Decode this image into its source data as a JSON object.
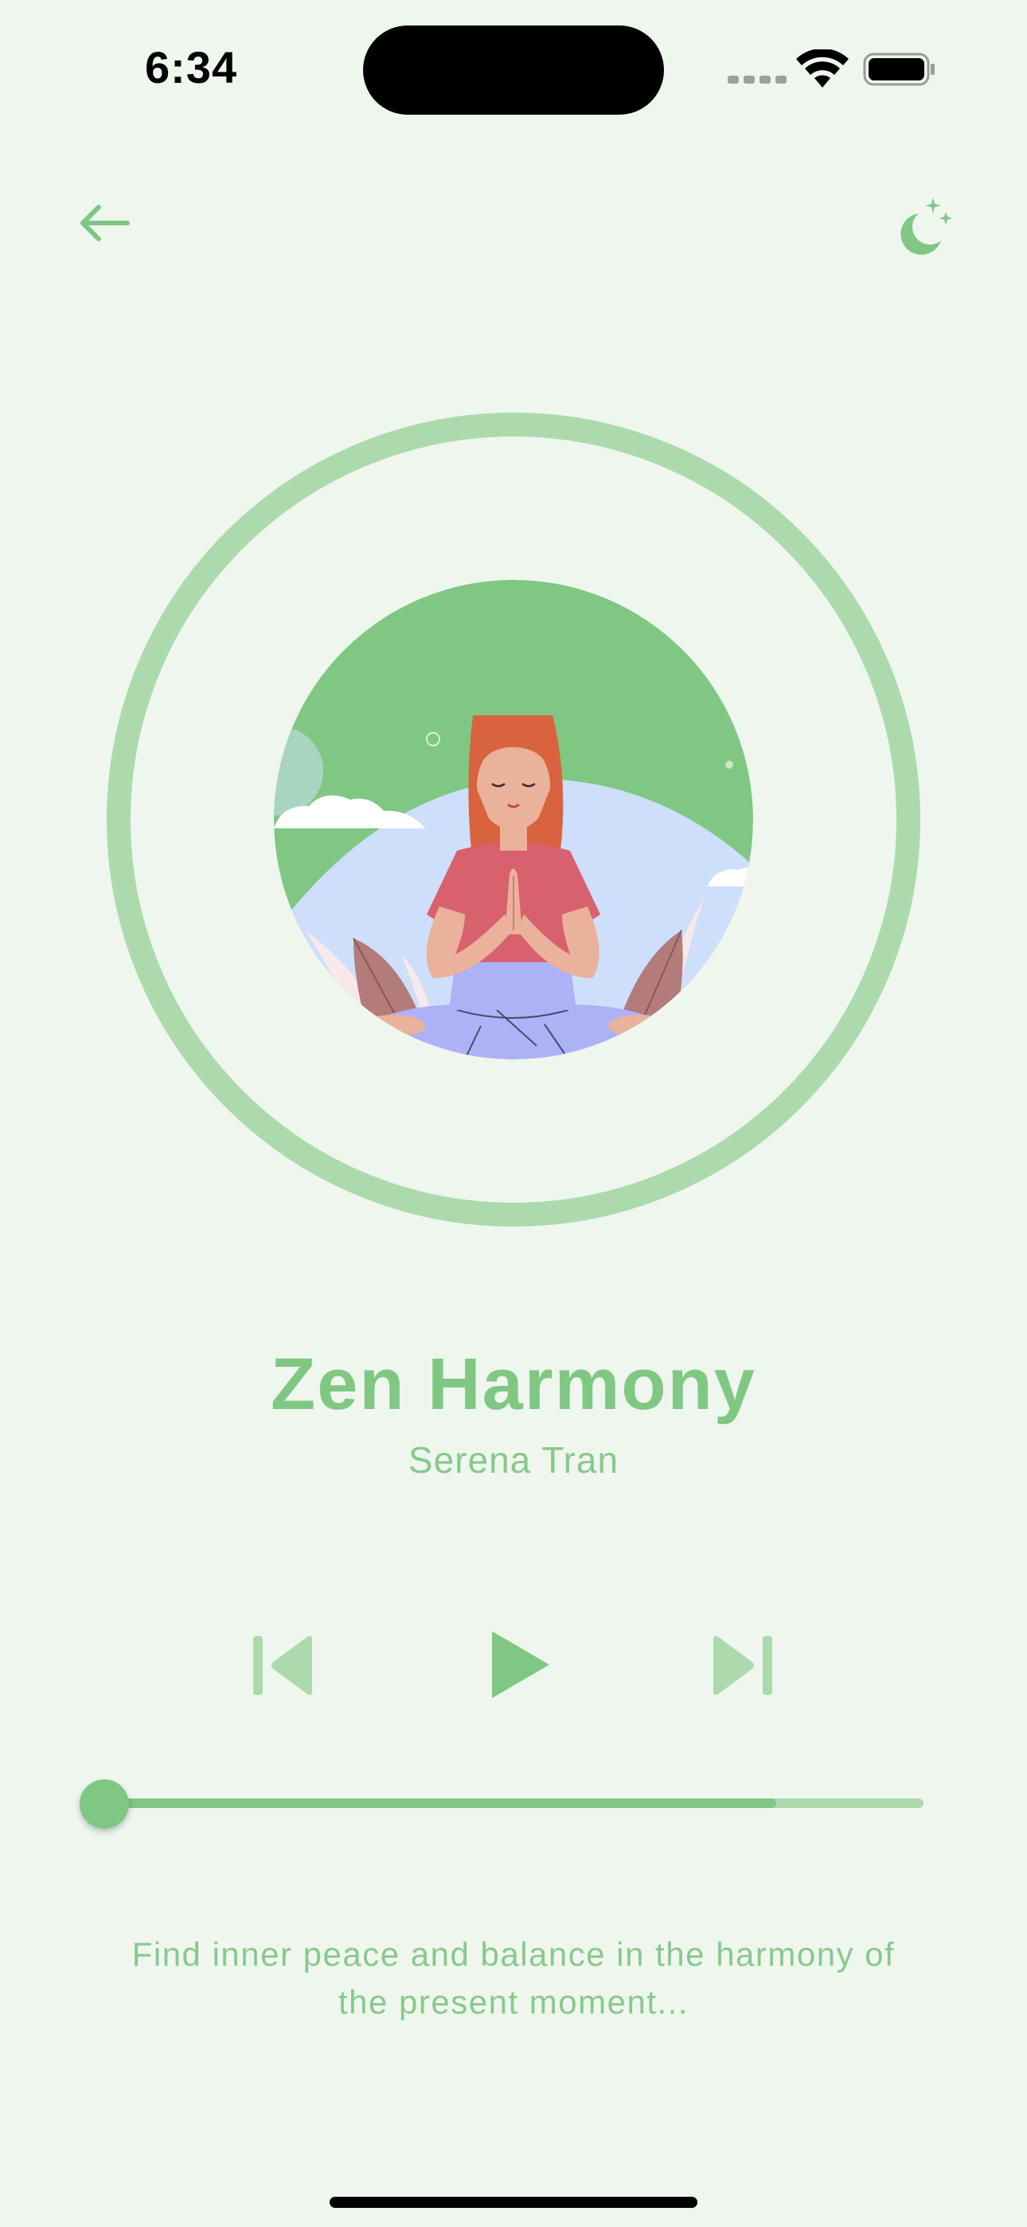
{
  "status_bar": {
    "time": "6:34"
  },
  "nav": {
    "back_icon": "arrow-left-icon",
    "theme_icon": "moon-stars-icon"
  },
  "track": {
    "title": "Zen Harmony",
    "artist": "Serena Tran",
    "description": "Find inner peace and balance in the harmony of the present moment...",
    "progress": 0.0,
    "buffered": 0.82
  },
  "controls": {
    "previous_icon": "skip-previous-icon",
    "play_icon": "play-icon",
    "next_icon": "skip-next-icon"
  },
  "colors": {
    "background": "#eef6ee",
    "accent": "#80c784",
    "accent_light": "#acdaad"
  }
}
